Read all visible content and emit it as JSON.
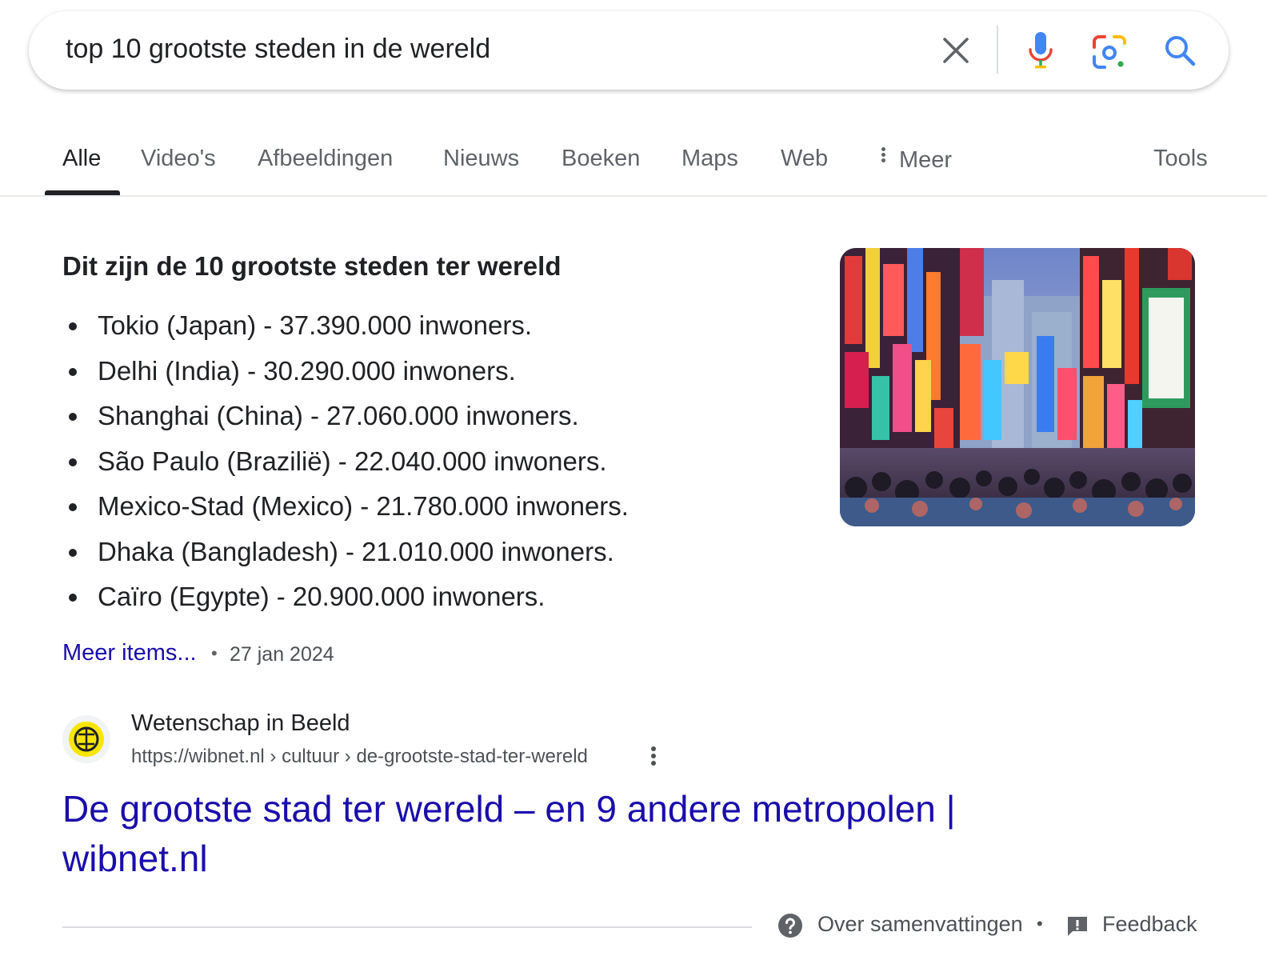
{
  "search": {
    "query": "top 10 grootste steden in de wereld"
  },
  "tabs": [
    {
      "label": "Alle",
      "active": true
    },
    {
      "label": "Video's"
    },
    {
      "label": "Afbeeldingen"
    },
    {
      "label": "Nieuws"
    },
    {
      "label": "Boeken"
    },
    {
      "label": "Maps"
    },
    {
      "label": "Web"
    },
    {
      "label": "Meer"
    }
  ],
  "tools_label": "Tools",
  "snippet": {
    "heading": "Dit zijn de 10 grootste steden ter wereld",
    "items": [
      "Tokio (Japan) - 37.390.000 inwoners.",
      "Delhi (India) - 30.290.000 inwoners.",
      "Shanghai (China) - 27.060.000 inwoners.",
      "São Paulo (Brazilië) - 22.040.000 inwoners.",
      "Mexico-Stad (Mexico) - 21.780.000 inwoners.",
      "Dhaka (Bangladesh) - 21.010.000 inwoners.",
      "Caïro (Egypte) - 20.900.000 inwoners."
    ],
    "more_link": "Meer items...",
    "separator": "•",
    "date": "27 jan 2024"
  },
  "result": {
    "site_name": "Wetenschap in Beeld",
    "url": "https://wibnet.nl › cultuur › de-grootste-stad-ter-wereld",
    "title": "De grootste stad ter wereld – en 9 andere metropolen | wibnet.nl"
  },
  "footer": {
    "about_label": "Over samenvattingen",
    "separator": "•",
    "feedback_label": "Feedback"
  },
  "colors": {
    "link": "#1a0dab",
    "text": "#202124",
    "muted": "#5f6368",
    "favicon_yellow": "#f7e600"
  },
  "icons": {
    "clear": "close-icon",
    "voice": "microphone-icon",
    "lens": "google-lens-icon",
    "search": "search-icon",
    "more": "vertical-dots-icon",
    "about": "question-icon",
    "feedback": "feedback-icon"
  }
}
